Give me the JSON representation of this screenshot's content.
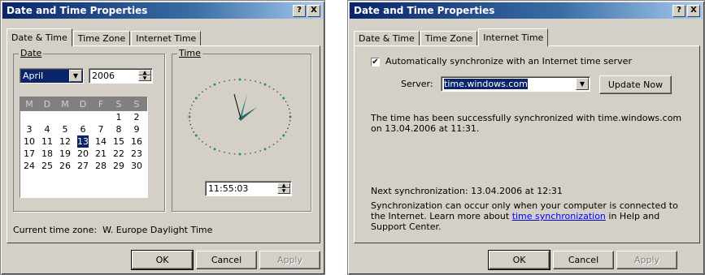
{
  "dialog_left": {
    "title": "Date and Time Properties",
    "title_buttons": [
      "?",
      "X"
    ],
    "tabs": [
      "Date & Time",
      "Time Zone",
      "Internet Time"
    ],
    "date_group": "Date",
    "time_group": "Time",
    "month": "April",
    "year": "2006",
    "weekdays": [
      "M",
      "D",
      "M",
      "D",
      "F",
      "S",
      "S"
    ],
    "calendar_rows": [
      [
        "",
        "",
        "",
        "",
        "",
        "1",
        "2"
      ],
      [
        "3",
        "4",
        "5",
        "6",
        "7",
        "8",
        "9"
      ],
      [
        "10",
        "11",
        "12",
        "13",
        "14",
        "15",
        "16"
      ],
      [
        "17",
        "18",
        "19",
        "20",
        "21",
        "22",
        "23"
      ],
      [
        "24",
        "25",
        "26",
        "27",
        "28",
        "29",
        "30"
      ]
    ],
    "selected_day": "13",
    "time_value": "11:55:03",
    "timezone_label": "Current time zone:",
    "timezone_value": "W. Europe Daylight Time",
    "ok": "OK",
    "cancel": "Cancel",
    "apply": "Apply"
  },
  "dialog_right": {
    "title": "Date and Time Properties",
    "title_buttons": [
      "?",
      "X"
    ],
    "tabs": [
      "Date & Time",
      "Time Zone",
      "Internet Time"
    ],
    "auto_sync_label": "Automatically synchronize with an Internet time server",
    "auto_sync_checked": true,
    "server_label": "Server:",
    "server_value": "time.windows.com",
    "update_button": "Update Now",
    "status_text": "The time has been successfully synchronized with time.windows.com on 13.04.2006 at 11:31.",
    "next_sync": "Next synchronization: 13.04.2006 at 12:31",
    "info_pre": "Synchronization can occur only when your computer is connected to the Internet.  Learn more about ",
    "info_link": "time synchronization",
    "info_post": " in Help and Support Center.",
    "ok": "OK",
    "cancel": "Cancel",
    "apply": "Apply"
  },
  "colors": {
    "title_bar": "#0a246a",
    "face": "#d4d0c8",
    "selection": "#0a246a",
    "clock_hand": "#3a8a8a",
    "link": "#0000ff"
  }
}
